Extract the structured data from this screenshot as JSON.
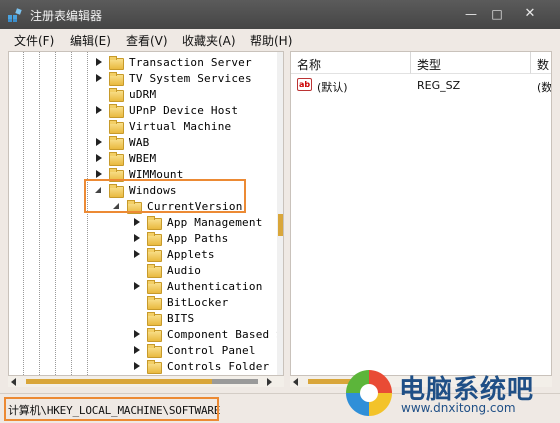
{
  "window": {
    "title": "注册表编辑器",
    "minimize_glyph": "—",
    "maximize_glyph": "□",
    "close_glyph": "✕"
  },
  "menu": [
    "文件(F)",
    "编辑(E)",
    "查看(V)",
    "收藏夹(A)",
    "帮助(H)"
  ],
  "tree": {
    "items": [
      {
        "label": "Transaction Server",
        "level": 0,
        "state": "collapsed"
      },
      {
        "label": "TV System Services",
        "level": 0,
        "state": "collapsed"
      },
      {
        "label": "uDRM",
        "level": 0,
        "state": "none"
      },
      {
        "label": "UPnP Device Host",
        "level": 0,
        "state": "collapsed"
      },
      {
        "label": "Virtual Machine",
        "level": 0,
        "state": "none"
      },
      {
        "label": "WAB",
        "level": 0,
        "state": "collapsed"
      },
      {
        "label": "WBEM",
        "level": 0,
        "state": "collapsed"
      },
      {
        "label": "WIMMount",
        "level": 0,
        "state": "collapsed"
      },
      {
        "label": "Windows",
        "level": 0,
        "state": "expanded"
      },
      {
        "label": "CurrentVersion",
        "level": 1,
        "state": "expanded"
      },
      {
        "label": "App Management",
        "level": 2,
        "state": "collapsed"
      },
      {
        "label": "App Paths",
        "level": 2,
        "state": "collapsed"
      },
      {
        "label": "Applets",
        "level": 2,
        "state": "collapsed"
      },
      {
        "label": "Audio",
        "level": 2,
        "state": "none"
      },
      {
        "label": "Authentication",
        "level": 2,
        "state": "collapsed"
      },
      {
        "label": "BitLocker",
        "level": 2,
        "state": "none"
      },
      {
        "label": "BITS",
        "level": 2,
        "state": "none"
      },
      {
        "label": "Component Based S",
        "level": 2,
        "state": "collapsed"
      },
      {
        "label": "Control Panel",
        "level": 2,
        "state": "collapsed"
      },
      {
        "label": "Controls Folder",
        "level": 2,
        "state": "collapsed"
      }
    ]
  },
  "values": {
    "columns": [
      "名称",
      "类型",
      "数"
    ],
    "rows": [
      {
        "name": "(默认)",
        "type": "REG_SZ",
        "data": "(数"
      }
    ],
    "icon_text": "ab"
  },
  "status": {
    "path": "计算机\\HKEY_LOCAL_MACHINE\\SOFTWARE"
  },
  "watermark": {
    "text": "电脑系统吧",
    "url": "www.dnxitong.com"
  },
  "colors": {
    "highlight": "#ec8a34",
    "titlebar": "#4e4e4e",
    "folder": "#e9b93f",
    "scroll_thumb": "#d9a63a"
  }
}
